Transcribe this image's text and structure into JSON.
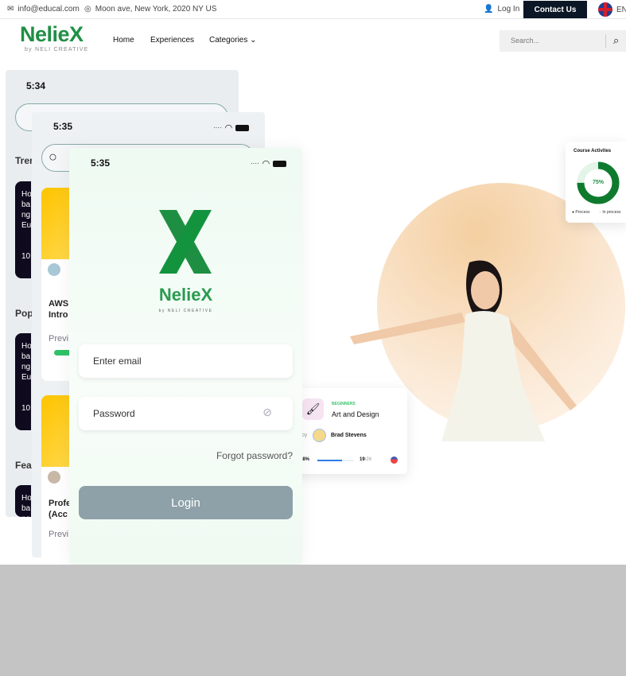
{
  "topbar": {
    "email": "info@educal.com",
    "address": "Moon ave, New York, 2020 NY US",
    "login": "Log In",
    "contact": "Contact Us",
    "lang": "EN"
  },
  "brand": {
    "name": "NelieX",
    "tagline": "by NELI CREATIVE"
  },
  "nav": {
    "items": [
      "Home",
      "Experiences",
      "Categories"
    ]
  },
  "search": {
    "placeholder": "Search..."
  },
  "phone_back": {
    "time": "5:34",
    "sections": [
      "Trer",
      "Pop",
      "Fea"
    ],
    "card_text": "Ho ba ng Eu",
    "card_num": "10"
  },
  "phone_mid": {
    "time": "5:35",
    "course1": "AWS Intro",
    "course2": "Profe (Acc",
    "preview": "Previ"
  },
  "phone_front": {
    "time": "5:35",
    "brand": "NelieX",
    "tagline": "by NELI CREATIVE",
    "email_placeholder": "Enter email",
    "password_placeholder": "Password",
    "forgot": "Forgot password?",
    "login": "Login"
  },
  "activity_card": {
    "title": "Course Activites",
    "percent": 75,
    "percent_label": "75%",
    "legend": [
      "Process",
      "In process"
    ],
    "colors": {
      "process": "#0e7a2e",
      "in_process": "#e3f4e8"
    }
  },
  "course_card": {
    "level": "BEGINNERS",
    "title": "Art and Design",
    "by": "by",
    "instructor": "Brad Stevens",
    "progress_label": "68%",
    "progress": 68,
    "lessons": "19",
    "total": "/26"
  },
  "colors": {
    "brand_green": "#1f8f45",
    "contact_bg": "#0b1626",
    "login_btn": "#8ea1a9"
  }
}
